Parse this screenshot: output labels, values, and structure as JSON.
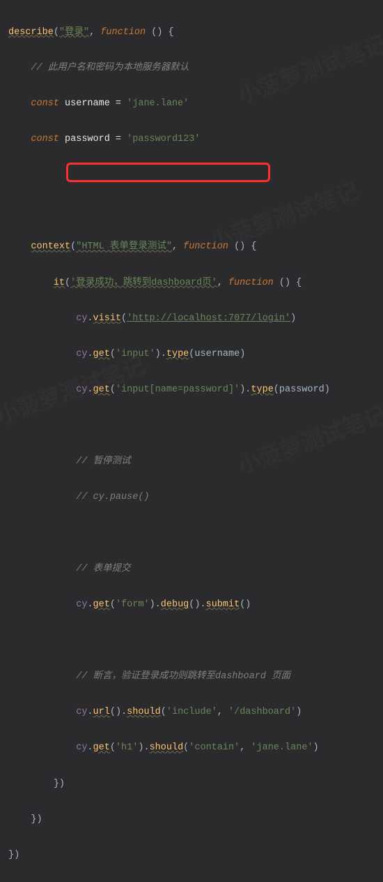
{
  "code": {
    "l1_describe": "describe",
    "l1_str": "\"登录\"",
    "l1_func": "function",
    "l1_rest": " () {",
    "l2_comment": "// 此用户名和密码为本地服务器默认",
    "l3_const": "const",
    "l3_var": " username = ",
    "l3_str": "'jane.lane'",
    "l4_const": "const",
    "l4_var": " password = ",
    "l4_str": "'password123'",
    "l6_context": "context",
    "l6_str": "\"HTML 表单登录测试\"",
    "l6_func": "function",
    "l6_rest": " () {",
    "l7_it": "it",
    "l7_str": "'登录成功，跳转到dashboard页'",
    "l7_func": "function",
    "l7_rest": " () {",
    "l8_cy": "cy",
    "l8_visit": "visit",
    "l8_str": "'http://localhost:7077/login'",
    "l9_cy": "cy",
    "l9_get": "get",
    "l9_str": "'input'",
    "l9_type": "type",
    "l9_arg": "username",
    "l10_cy": "cy",
    "l10_get": "get",
    "l10_str": "'input[name=password]'",
    "l10_type": "type",
    "l10_arg": "password",
    "l12_comment": "// 暂停测试",
    "l13_comment": "// cy.pause()",
    "l15_comment": "// 表单提交",
    "l16_cy": "cy",
    "l16_get": "get",
    "l16_str": "'form'",
    "l16_debug": "debug",
    "l16_submit": "submit",
    "l18_comment": "// 断言，验证登录成功则跳转至dashboard 页面",
    "l19_cy": "cy",
    "l19_url": "url",
    "l19_should": "should",
    "l19_str1": "'include'",
    "l19_str2": "'/dashboard'",
    "l20_cy": "cy",
    "l20_get": "get",
    "l20_str": "'h1'",
    "l20_should": "should",
    "l20_str1": "'contain'",
    "l20_str2": "'jane.lane'",
    "close1": "})",
    "close2": "})",
    "close3": "})"
  },
  "watermark": "小菠萝测试笔记"
}
